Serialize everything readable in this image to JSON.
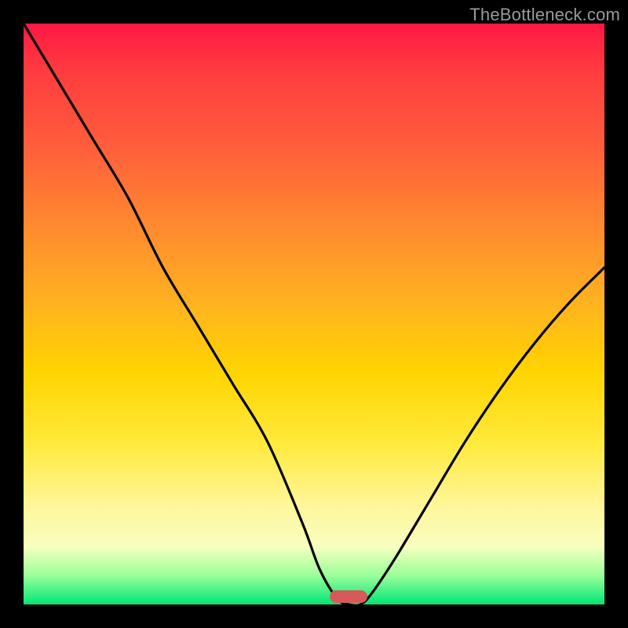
{
  "watermark": "TheBottleneck.com",
  "marker": {
    "color": "#d65a5a"
  },
  "chart_data": {
    "type": "line",
    "title": "",
    "xlabel": "",
    "ylabel": "",
    "xlim": [
      0,
      100
    ],
    "ylim": [
      0,
      100
    ],
    "x": [
      0,
      6,
      12,
      18,
      24,
      30,
      36,
      42,
      48,
      51,
      54,
      56,
      58,
      60,
      64,
      70,
      76,
      82,
      88,
      94,
      100
    ],
    "values": [
      100,
      90,
      80,
      70,
      58,
      48,
      38,
      28,
      14,
      6,
      1,
      0,
      0,
      2,
      8,
      18,
      28,
      37,
      45,
      52,
      58
    ],
    "series_name": "bottleneck-curve",
    "optimal_x": 56,
    "gradient_stops": [
      {
        "pos": 0,
        "color": "#ff1744"
      },
      {
        "pos": 8,
        "color": "#ff3b3f"
      },
      {
        "pos": 20,
        "color": "#ff5a3c"
      },
      {
        "pos": 35,
        "color": "#ff8a2f"
      },
      {
        "pos": 48,
        "color": "#ffb220"
      },
      {
        "pos": 60,
        "color": "#ffd400"
      },
      {
        "pos": 72,
        "color": "#ffe93a"
      },
      {
        "pos": 83,
        "color": "#fff69a"
      },
      {
        "pos": 90,
        "color": "#f7ffbf"
      },
      {
        "pos": 95,
        "color": "#9bff9a"
      },
      {
        "pos": 100,
        "color": "#00e676"
      }
    ]
  }
}
